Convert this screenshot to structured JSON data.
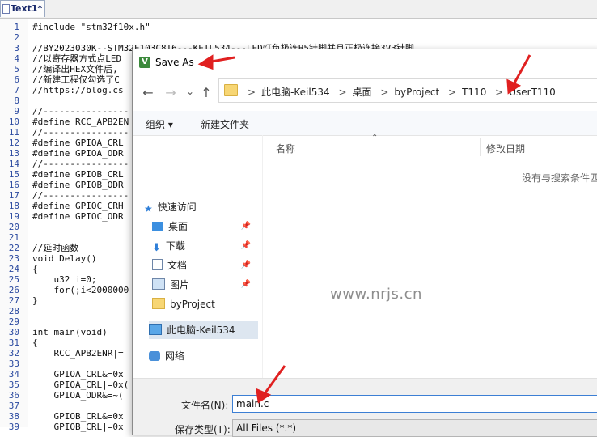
{
  "editor": {
    "tab_label": "Text1*",
    "lines": [
      {
        "n": "1",
        "text": "#include \"stm32f10x.h\""
      },
      {
        "n": "2",
        "text": ""
      },
      {
        "n": "3",
        "text": "//BY2023030K--STM32F103C8T6---KEIL534---LED灯负极连B5针脚并且正极连接3V3针脚"
      },
      {
        "n": "4",
        "text": "//以寄存器方式点LED"
      },
      {
        "n": "5",
        "text": "//编译出HEX文件后,"
      },
      {
        "n": "6",
        "text": "//新建工程仅勾选了C"
      },
      {
        "n": "7",
        "text": "//https://blog.cs"
      },
      {
        "n": "8",
        "text": ""
      },
      {
        "n": "9",
        "text": "//----------------"
      },
      {
        "n": "10",
        "text": "#define RCC_APB2EN"
      },
      {
        "n": "11",
        "text": "//----------------"
      },
      {
        "n": "12",
        "text": "#define GPIOA_CRL"
      },
      {
        "n": "13",
        "text": "#define GPIOA_ODR"
      },
      {
        "n": "14",
        "text": "//----------------"
      },
      {
        "n": "15",
        "text": "#define GPIOB_CRL"
      },
      {
        "n": "16",
        "text": "#define GPIOB_ODR"
      },
      {
        "n": "17",
        "text": "//----------------"
      },
      {
        "n": "18",
        "text": "#define GPIOC_CRH"
      },
      {
        "n": "19",
        "text": "#define GPIOC_ODR"
      },
      {
        "n": "20",
        "text": ""
      },
      {
        "n": "21",
        "text": ""
      },
      {
        "n": "22",
        "text": "//延时函数"
      },
      {
        "n": "23",
        "text": "void Delay()"
      },
      {
        "n": "24",
        "text": "{"
      },
      {
        "n": "25",
        "text": "    u32 i=0;"
      },
      {
        "n": "26",
        "text": "    for(;i<2000000"
      },
      {
        "n": "27",
        "text": "}"
      },
      {
        "n": "28",
        "text": ""
      },
      {
        "n": "29",
        "text": ""
      },
      {
        "n": "30",
        "text": "int main(void)"
      },
      {
        "n": "31",
        "text": "{"
      },
      {
        "n": "32",
        "text": "    RCC_APB2ENR|="
      },
      {
        "n": "33",
        "text": ""
      },
      {
        "n": "34",
        "text": "    GPIOA_CRL&=0x"
      },
      {
        "n": "35",
        "text": "    GPIOA_CRL|=0x("
      },
      {
        "n": "36",
        "text": "    GPIOA_ODR&=~("
      },
      {
        "n": "37",
        "text": ""
      },
      {
        "n": "38",
        "text": "    GPIOB_CRL&=0x"
      },
      {
        "n": "39",
        "text": "    GPIOB_CRL|=0x"
      }
    ]
  },
  "dialog": {
    "title": "Save As",
    "nav": {
      "back": "←",
      "forward": "→",
      "dropdown": "⌄",
      "up": "↑"
    },
    "breadcrumb": [
      "此电脑-Keil534",
      "桌面",
      "byProject",
      "T110",
      "UserT110"
    ],
    "breadcrumb_sep": ">",
    "toolbar": {
      "organize": "组织 ▾",
      "new_folder": "新建文件夹"
    },
    "sidebar": [
      {
        "label": "快速访问",
        "pinned": false
      },
      {
        "label": "桌面",
        "pinned": true
      },
      {
        "label": "下载",
        "pinned": true
      },
      {
        "label": "文档",
        "pinned": true
      },
      {
        "label": "图片",
        "pinned": true
      },
      {
        "label": "byProject",
        "pinned": false
      },
      {
        "label": "此电脑-Keil534",
        "pinned": false
      },
      {
        "label": "网络",
        "pinned": false
      }
    ],
    "columns": {
      "name": "名称",
      "modified": "修改日期"
    },
    "empty_message": "没有与搜索条件匹",
    "filename_label": "文件名(N):",
    "filename_value": "main.c",
    "filetype_label": "保存类型(T):",
    "filetype_value": "All Files (*.*)"
  },
  "watermark": "www.nrjs.cn",
  "colors": {
    "accent": "#3c7fd4",
    "arrow": "#e02020",
    "linenum": "#2b4aa0"
  }
}
